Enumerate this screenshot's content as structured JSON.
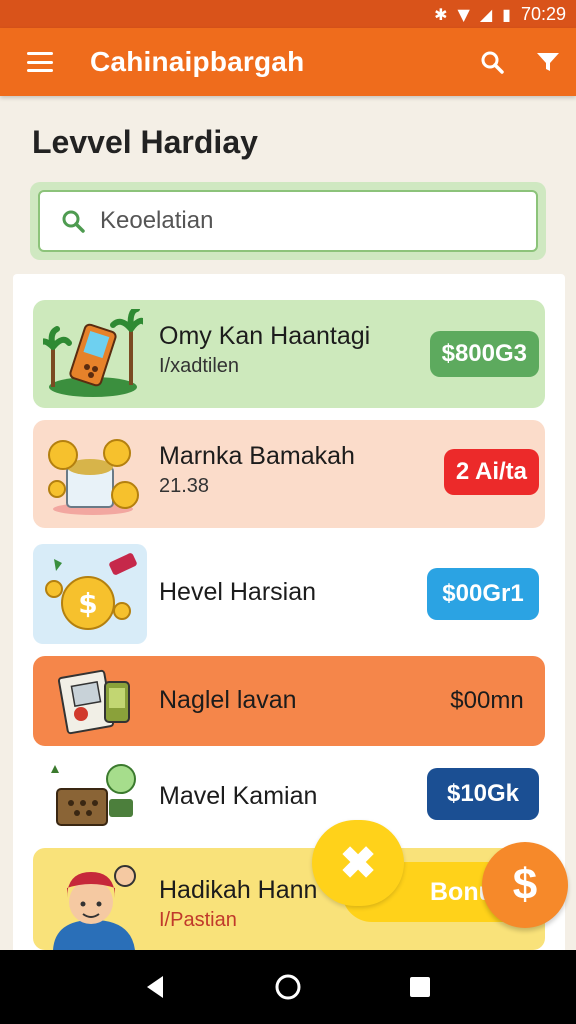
{
  "status_bar": {
    "time": "70:29"
  },
  "app_bar": {
    "title": "Cahinaipbargah"
  },
  "page": {
    "title": "Levvel Hardiay"
  },
  "search": {
    "text": "Keoelatian"
  },
  "cards": [
    {
      "title": "Omy Kan Haantagi",
      "subtitle": "I/xadtilen",
      "price": "$800G3",
      "bg": "#cde9bc",
      "pill_color": "#5daa5e",
      "icon": "phone-island-icon"
    },
    {
      "title": "Marnka Bamakah",
      "subtitle": "21.38",
      "price": "2 Ai/ta",
      "bg": "#fbdcca",
      "pill_color": "#ec2a2a",
      "icon": "coin-bucket-icon"
    },
    {
      "title": "Hevel Harsian",
      "subtitle": "",
      "price": "$00Gr1",
      "bg": "#ffffff",
      "pill_color": "#2ba3e3",
      "icon": "money-bag-icon"
    },
    {
      "title": "Naglel lavan",
      "subtitle": "",
      "price": "$00mn",
      "bg": "#f5864a",
      "pill_color": "#f5864a",
      "icon": "book-icon"
    },
    {
      "title": "Mavel Kamian",
      "subtitle": "",
      "price": "$10Gk",
      "bg": "#ffffff",
      "pill_color": "#1b4f93",
      "icon": "wallet-icon"
    },
    {
      "title": "Hadikah Hann",
      "subtitle": "I/Pastian",
      "price": "",
      "bg": "#f9e27a",
      "pill_color": "#f9e27a",
      "icon": "avatar-icon"
    }
  ],
  "bonus": {
    "label": "Bonus",
    "coin": "$"
  }
}
